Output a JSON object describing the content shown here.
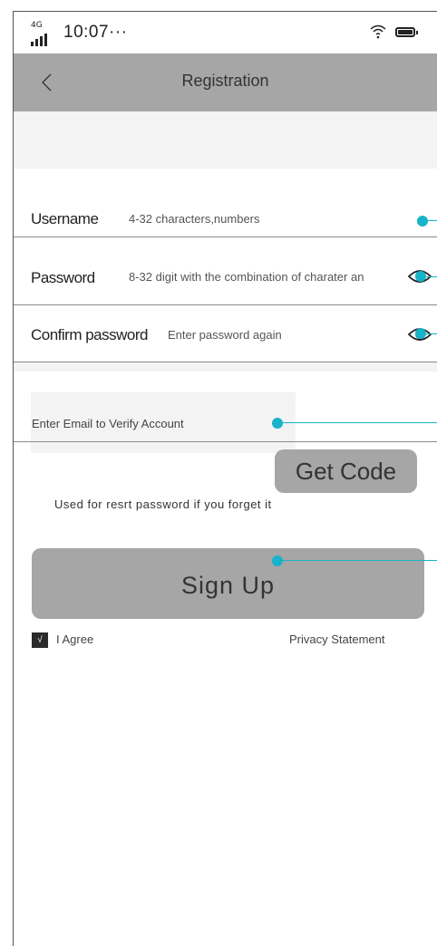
{
  "status_bar": {
    "network": "4G",
    "time": "10:07···"
  },
  "header": {
    "title": "Registration",
    "back_icon": "chevron-left-icon"
  },
  "form": {
    "username": {
      "label": "Username",
      "placeholder": "4-32 characters,numbers"
    },
    "password": {
      "label": "Password",
      "placeholder": "8-32 digit with the combination of charater an",
      "toggle_icon": "eye-icon"
    },
    "confirm_password": {
      "label": "Confirm password",
      "placeholder": "Enter password again",
      "toggle_icon": "eye-icon"
    },
    "email": {
      "placeholder": "Enter Email to Verify Account"
    },
    "get_code_label": "Get Code",
    "helper_text": "Used for resrt password if you forget it",
    "sign_up_label": "Sign Up"
  },
  "agreement": {
    "checked": true,
    "check_mark": "√",
    "label": "I Agree",
    "privacy_link": "Privacy Statement"
  },
  "colors": {
    "bar_gray": "#a6a6a6",
    "band_gray": "#f3f3f3",
    "callout_accent": "#17b3c8"
  }
}
